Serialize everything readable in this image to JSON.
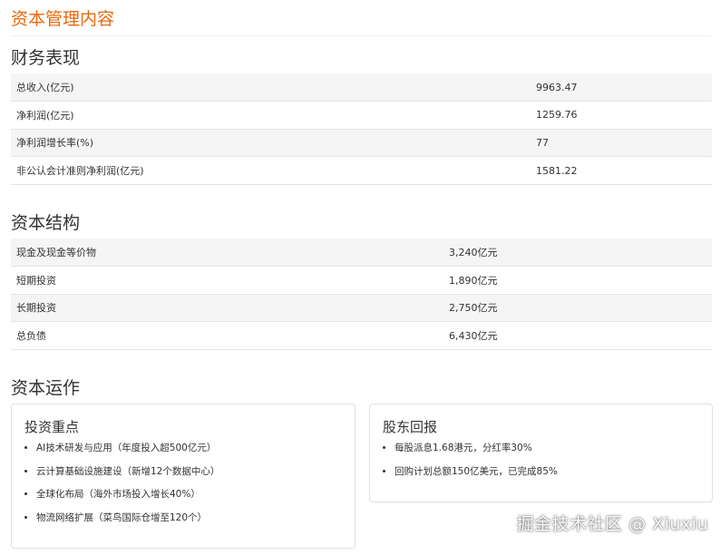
{
  "page_title": "资本管理内容",
  "financial": {
    "heading": "财务表现",
    "rows": [
      {
        "label": "总收入(亿元)",
        "value": "9963.47"
      },
      {
        "label": "净利润(亿元)",
        "value": "1259.76"
      },
      {
        "label": "净利润增长率(%)",
        "value": "77"
      },
      {
        "label": "非公认会计准则净利润(亿元)",
        "value": "1581.22"
      }
    ]
  },
  "structure": {
    "heading": "资本结构",
    "rows": [
      {
        "label": "现金及现金等价物",
        "value": "3,240亿元"
      },
      {
        "label": "短期投资",
        "value": "1,890亿元"
      },
      {
        "label": "长期投资",
        "value": "2,750亿元"
      },
      {
        "label": "总负债",
        "value": "6,430亿元"
      }
    ]
  },
  "operation": {
    "heading": "资本运作",
    "investment": {
      "title": "投资重点",
      "items": [
        "AI技术研发与应用（年度投入超500亿元）",
        "云计算基础设施建设（新增12个数据中心）",
        "全球化布局（海外市场投入增长40%）",
        "物流网络扩展（菜鸟国际仓增至120个）"
      ]
    },
    "returns": {
      "title": "股东回报",
      "items": [
        "每股派息1.68港元，分红率30%",
        "回购计划总额150亿美元，已完成85%"
      ]
    }
  },
  "watermark": "掘金技术社区 @ Xiuxiu"
}
